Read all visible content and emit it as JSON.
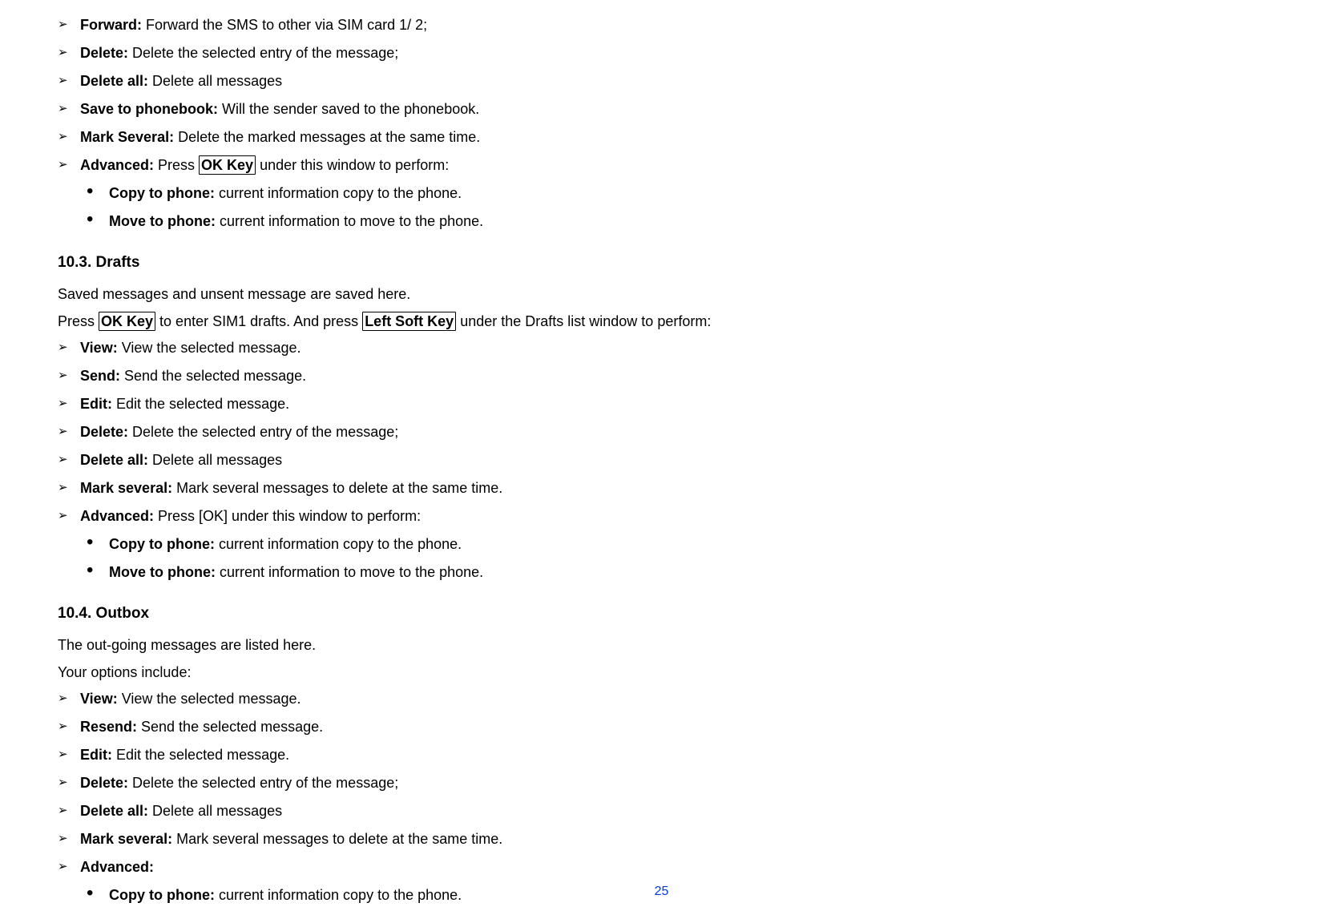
{
  "a": {
    "forward": {
      "k": "Forward:",
      "v": " Forward the SMS to other via SIM card   1/ 2;"
    },
    "delete": {
      "k": "Delete:",
      "v": " Delete the selected entry of the message;"
    },
    "deleteall": {
      "k": "Delete all:",
      "v": " Delete all messages"
    },
    "save": {
      "k": "Save to phonebook:",
      "v": " Will the sender saved to the phonebook."
    },
    "mark": {
      "k": "Mark Several:",
      "v": " Delete the marked messages at the same time."
    },
    "adv": {
      "k": "Advanced:",
      "pre": " Press ",
      "key": "OK Key",
      "post": " under this window to perform:"
    },
    "copy": {
      "k": "Copy to phone:",
      "v": " current information copy to the phone."
    },
    "move": {
      "k": "Move to phone:",
      "v": " current information to move to the phone."
    }
  },
  "s103": {
    "h": "10.3.   Drafts",
    "p1": "Saved messages and unsent message are saved here.",
    "p2a": "Press ",
    "p2key1": "OK Key",
    "p2b": " to enter SIM1 drafts. And press ",
    "p2key2": "Left Soft Key",
    "p2c": " under the Drafts list window to perform:",
    "view": {
      "k": "View:",
      "v": " View the selected message."
    },
    "send": {
      "k": "Send:",
      "v": " Send the selected message."
    },
    "edit": {
      "k": "Edit:",
      "v": " Edit the selected message."
    },
    "del": {
      "k": "Delete:",
      "v": " Delete the selected entry of the message;"
    },
    "delall": {
      "k": "Delete all:",
      "v": " Delete all messages"
    },
    "mark": {
      "k": "Mark several:",
      "v": " Mark several messages to delete at the same time."
    },
    "adv": {
      "k": "Advanced:",
      "v": " Press [OK] under this window to perform:"
    },
    "copy": {
      "k": "Copy to phone:",
      "v": " current information copy to the phone."
    },
    "move": {
      "k": "Move to phone:",
      "v": " current information to move to the phone."
    }
  },
  "s104": {
    "h": "10.4.   Outbox",
    "p1": "The out-going messages are listed here.",
    "p2": "Your options include:",
    "view": {
      "k": "View:",
      "v": " View the selected message."
    },
    "resend": {
      "k": "Resend:",
      "v": " Send the selected message."
    },
    "edit": {
      "k": "Edit:",
      "v": " Edit the selected message."
    },
    "del": {
      "k": "Delete:",
      "v": " Delete the selected entry of the message;"
    },
    "delall": {
      "k": "Delete all:",
      "v": " Delete all messages"
    },
    "mark": {
      "k": "Mark several:",
      "v": " Mark several messages to delete at the same time."
    },
    "adv": {
      "k": "Advanced:"
    },
    "copy": {
      "k": "Copy to phone:",
      "v": " current information copy to the phone."
    }
  },
  "page": "25"
}
